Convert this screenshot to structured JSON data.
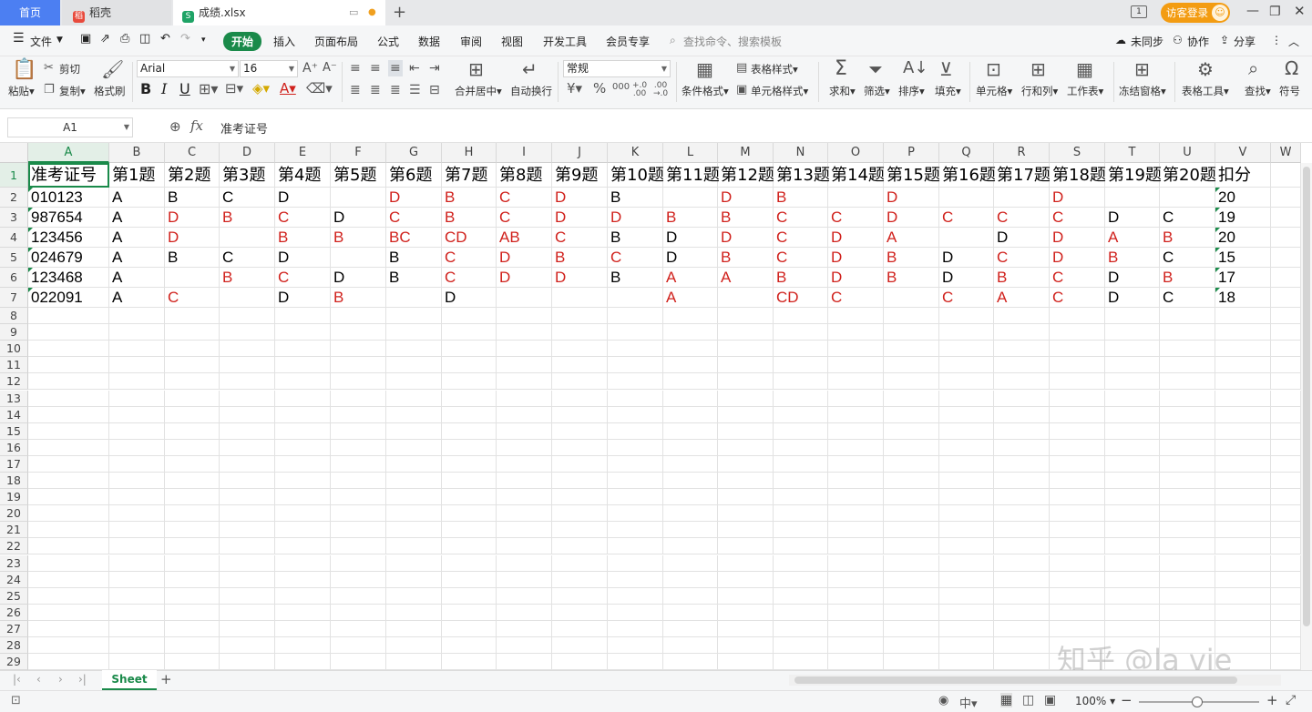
{
  "tabs": {
    "home": "首页",
    "daoke": "稻壳",
    "file": "成绩.xlsx",
    "login": "访客登录"
  },
  "menu": {
    "file": "文件",
    "items": [
      "开始",
      "插入",
      "页面布局",
      "公式",
      "数据",
      "审阅",
      "视图",
      "开发工具",
      "会员专享"
    ],
    "search": "查找命令、搜索模板",
    "sync": "未同步",
    "collab": "协作",
    "share": "分享"
  },
  "ribbon": {
    "paste": "粘贴",
    "cut": "剪切",
    "copy": "复制",
    "format_painter": "格式刷",
    "font_name": "Arial",
    "font_size": "16",
    "merge": "合并居中",
    "wrap": "自动换行",
    "number_format": "常规",
    "cond_format": "条件格式",
    "table_style": "表格样式",
    "cell_style": "单元格样式",
    "sum": "求和",
    "filter": "筛选",
    "sort": "排序",
    "fill": "填充",
    "cell": "单元格",
    "rowcol": "行和列",
    "worksheet": "工作表",
    "freeze": "冻结窗格",
    "table_tools": "表格工具",
    "find": "查找",
    "symbol": "符号"
  },
  "formula": {
    "cell_ref": "A1",
    "fx": "fx",
    "content": "准考证号"
  },
  "sheet": {
    "columns": [
      "A",
      "B",
      "C",
      "D",
      "E",
      "F",
      "G",
      "H",
      "I",
      "J",
      "K",
      "L",
      "M",
      "N",
      "O",
      "P",
      "Q",
      "R",
      "S",
      "T",
      "U",
      "V",
      "W"
    ],
    "header_row": [
      "准考证号",
      "第1题",
      "第2题",
      "第3题",
      "第4题",
      "第5题",
      "第6题",
      "第7题",
      "第8题",
      "第9题",
      "第10题",
      "第11题",
      "第12题",
      "第13题",
      "第14题",
      "第15题",
      "第16题",
      "第17题",
      "第18题",
      "第19题",
      "第20题",
      "扣分"
    ],
    "rows": [
      [
        "010123",
        "A",
        "B",
        "C",
        "D",
        "",
        "D",
        "B",
        "C",
        "D",
        "B",
        "",
        "D",
        "B",
        "",
        "D",
        "",
        "",
        "D",
        "",
        "",
        "20"
      ],
      [
        "987654",
        "A",
        "D",
        "B",
        "C",
        "D",
        "C",
        "B",
        "C",
        "D",
        "D",
        "B",
        "B",
        "C",
        "C",
        "D",
        "C",
        "C",
        "C",
        "D",
        "C",
        "19"
      ],
      [
        "123456",
        "A",
        "D",
        "",
        "B",
        "B",
        "BC",
        "CD",
        "AB",
        "C",
        "B",
        "D",
        "D",
        "C",
        "D",
        "A",
        "",
        "D",
        "D",
        "A",
        "B",
        "20"
      ],
      [
        "024679",
        "A",
        "B",
        "C",
        "D",
        "",
        "B",
        "C",
        "D",
        "B",
        "C",
        "D",
        "B",
        "C",
        "D",
        "B",
        "D",
        "C",
        "D",
        "B",
        "C",
        "15"
      ],
      [
        "123468",
        "A",
        "",
        "B",
        "C",
        "D",
        "B",
        "C",
        "D",
        "D",
        "B",
        "A",
        "A",
        "B",
        "D",
        "B",
        "D",
        "B",
        "C",
        "D",
        "B",
        "17"
      ],
      [
        "022091",
        "A",
        "C",
        "",
        "D",
        "B",
        "",
        "D",
        "",
        "",
        "",
        "A",
        "",
        "CD",
        "C",
        "",
        "C",
        "A",
        "C",
        "D",
        "C",
        "18"
      ]
    ],
    "red_flags": [
      [
        0,
        0,
        0,
        0,
        0,
        0,
        1,
        1,
        1,
        1,
        0,
        0,
        1,
        1,
        0,
        1,
        0,
        0,
        1,
        0,
        0,
        0
      ],
      [
        0,
        0,
        1,
        1,
        1,
        0,
        1,
        1,
        1,
        1,
        1,
        1,
        1,
        1,
        1,
        1,
        1,
        1,
        1,
        0,
        0,
        0
      ],
      [
        0,
        0,
        1,
        0,
        1,
        1,
        1,
        1,
        1,
        1,
        0,
        0,
        1,
        1,
        1,
        1,
        0,
        0,
        1,
        1,
        1,
        0
      ],
      [
        0,
        0,
        0,
        0,
        0,
        0,
        0,
        1,
        1,
        1,
        1,
        0,
        1,
        1,
        1,
        1,
        0,
        1,
        1,
        1,
        0,
        0
      ],
      [
        0,
        0,
        0,
        1,
        1,
        0,
        0,
        1,
        1,
        1,
        0,
        1,
        1,
        1,
        1,
        1,
        0,
        1,
        1,
        0,
        1,
        0
      ],
      [
        0,
        0,
        1,
        0,
        0,
        1,
        0,
        0,
        0,
        0,
        0,
        1,
        0,
        1,
        1,
        0,
        1,
        1,
        1,
        0,
        0,
        0
      ]
    ],
    "row_numbers": [
      "1",
      "2",
      "3",
      "4",
      "5",
      "6",
      "7",
      "8",
      "9",
      "10",
      "11",
      "12",
      "13",
      "14",
      "15",
      "16",
      "17",
      "18",
      "19",
      "20",
      "21",
      "22",
      "23",
      "24",
      "25",
      "26",
      "27",
      "28",
      "29"
    ],
    "sheet_tab": "Sheet"
  },
  "status": {
    "zoom": "100%"
  },
  "watermark": "知乎 @la vie",
  "colors": {
    "accent": "#1a8a4a",
    "red": "#d0211c",
    "login": "#f39c12"
  }
}
